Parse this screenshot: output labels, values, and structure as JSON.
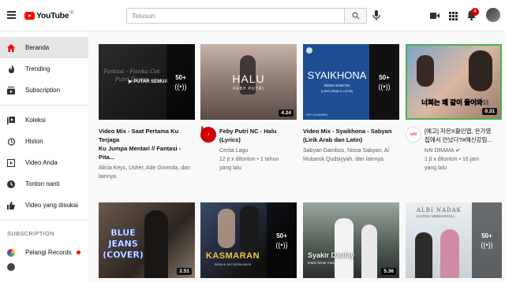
{
  "header": {
    "logo_text": "YouTube",
    "logo_region": "ID",
    "search_placeholder": "Telusuri",
    "notification_count": "4",
    "brand_color": "#ff0000"
  },
  "sidebar": {
    "items": [
      {
        "label": "Beranda",
        "icon": "home-icon"
      },
      {
        "label": "Trending",
        "icon": "flame-icon"
      },
      {
        "label": "Subscription",
        "icon": "subscriptions-icon"
      },
      {
        "label": "Koleksi",
        "icon": "library-icon"
      },
      {
        "label": "Histori",
        "icon": "history-icon"
      },
      {
        "label": "Video Anda",
        "icon": "your-videos-icon"
      },
      {
        "label": "Tonton nanti",
        "icon": "watch-later-icon"
      },
      {
        "label": "Video yang disukai",
        "icon": "thumbs-up-icon"
      }
    ],
    "subscription_title": "SUBSCRIPTION",
    "subscriptions": [
      {
        "label": "Pelangi Records"
      }
    ]
  },
  "videos": [
    {
      "title_line1": "Video Mix - Saat Pertama Ku Terjaga",
      "title_line2": "Ku Jumpa Mentari // Fantasi - Pita...",
      "meta1": "Alicia Keys, Usher, Ade Govinda, dan",
      "meta2": "lainnya",
      "thumb_text": "PUTAR SEMUA",
      "thumb_overlay": "Fantasi - Fisnka Cot Putri Dayan",
      "mix_count": "50+"
    },
    {
      "title_line1": "Feby Putri NC - Halu (Lyrics)",
      "title_line2": "",
      "meta1": "Cerita Lagu",
      "meta2": "12 jt x ditonton • 1 tahun yang lalu",
      "thumb_title": "HALU",
      "thumb_sub": "FEBY PUTRI",
      "duration": "4.24"
    },
    {
      "title_line1": "Video Mix - Syaikhona - Sabyan",
      "title_line2": "(Lirik Arab dan Latin)",
      "meta1": "Sabyan Gambus, Nissa Sabyan, Al",
      "meta2": "Mubarok Qudsiyyah, dan lainnya",
      "thumb_title": "SYAIKHONA",
      "thumb_sub": "NISSA SABYAN",
      "thumb_sub2": "(LIRIK ARAB & LATIN)",
      "thumb_footer": "HIFI CHANNEL",
      "mix_count": "50+"
    },
    {
      "title_line1": "[예고] 자은X황민엽, 은가영",
      "title_line2": "집에서 만났다?#예신강림...",
      "meta1": "tvN DRAMA",
      "meta2": "1 jt x ditonton • 16 jam yang lalu",
      "thumb_caption": "너희는 왜 같이 들어와?!",
      "duration": "0.31"
    },
    {
      "thumb_title": "BLUE JEANS (COVER)",
      "duration": "2.51"
    },
    {
      "thumb_title": "KASMARAN",
      "thumb_sub": "INDIA & JAY DEFALANZA",
      "mix_count": "50+"
    },
    {
      "thumb_title": "Syakir Daulay",
      "thumb_sub": "Imam besar masjid",
      "duration": "5.36"
    },
    {
      "thumb_title": "ALBI NADAK",
      "thumb_sub": "(HATIKU MEMANGGIL)",
      "mix_count": "50+"
    }
  ]
}
